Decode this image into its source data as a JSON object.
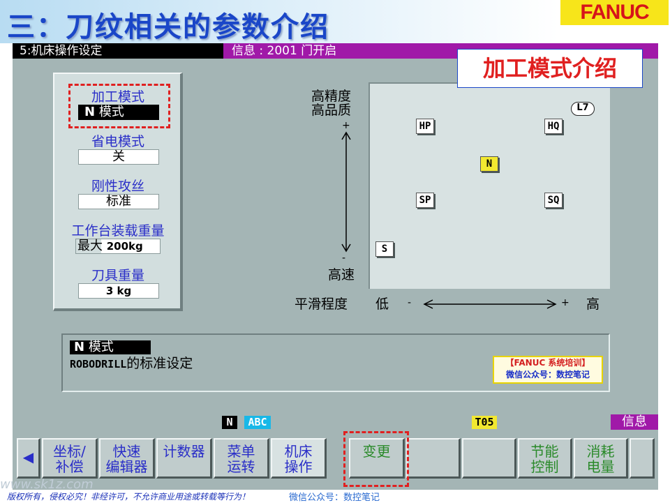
{
  "slide": {
    "title": "三：刀纹相关的参数介绍",
    "logo": "FANUC"
  },
  "screen": {
    "title": "5:机床操作设定",
    "info": "信息 : 2001 门开启"
  },
  "settings": {
    "machining_mode": {
      "label": "加工模式",
      "value_prefix": "N",
      "value": "模式"
    },
    "power_saving": {
      "label": "省电模式",
      "value": "关"
    },
    "rigid_tapping": {
      "label": "刚性攻丝",
      "value": "标准"
    },
    "table_load": {
      "label": "工作台装载重量",
      "prefix": "最大",
      "value": "200kg"
    },
    "tool_weight": {
      "label": "刀具重量",
      "value": "3 kg"
    }
  },
  "diagram": {
    "y_top_line1": "高精度",
    "y_top_line2": "高品质",
    "y_bottom": "高速",
    "plus": "+",
    "minus": "-",
    "x_label": "平滑程度",
    "x_low": "低",
    "x_minus": "-",
    "x_plus": "+",
    "x_high": "高",
    "modes": [
      {
        "name": "HP",
        "selected": false
      },
      {
        "name": "HQ",
        "selected": false
      },
      {
        "name": "N",
        "selected": true
      },
      {
        "name": "SP",
        "selected": false
      },
      {
        "name": "SQ",
        "selected": false
      },
      {
        "name": "S",
        "selected": false
      }
    ],
    "badge": "L7"
  },
  "message": {
    "title_prefix": "N",
    "title": "模式",
    "desc_bold": "ROBODRILL",
    "desc": "的标准设定",
    "watermark_line1": "【FANUC 系统培训】",
    "watermark_line2": "微信公众号：数控笔记"
  },
  "status": {
    "mode": "N",
    "input": "ABC",
    "tool": "T05",
    "info": "信息"
  },
  "softkeys": [
    {
      "line1": "坐标/",
      "line2": "补偿"
    },
    {
      "line1": "快速",
      "line2": "编辑器"
    },
    {
      "line1": "计数器",
      "line2": ""
    },
    {
      "line1": "菜单",
      "line2": "运转"
    },
    {
      "line1": "机床",
      "line2": "操作"
    },
    {
      "line1": "变更",
      "line2": ""
    },
    {
      "line1": "",
      "line2": ""
    },
    {
      "line1": "",
      "line2": ""
    },
    {
      "line1": "节能",
      "line2": "控制"
    },
    {
      "line1": "消耗",
      "line2": "电量"
    },
    {
      "line1": "",
      "line2": ""
    }
  ],
  "back_arrow": "◀",
  "annotation": {
    "title": "加工模式介绍"
  },
  "footer": {
    "copyright": "版权所有，侵权必究！非经许可，不允许商业用途或转载等行为！",
    "wechat": "微信公众号：数控笔记",
    "site": "www.sk1z.com"
  },
  "colors": {
    "slide_title": "#1a46c8",
    "logo_bg": "#f7e51a",
    "logo_text": "#d6141a",
    "screen_bg": "#a4b5b5",
    "info_bar": "#a019a8",
    "label_blue": "#2a2ec8",
    "mode_selected": "#f2e830",
    "highlight_red": "#e02020"
  }
}
